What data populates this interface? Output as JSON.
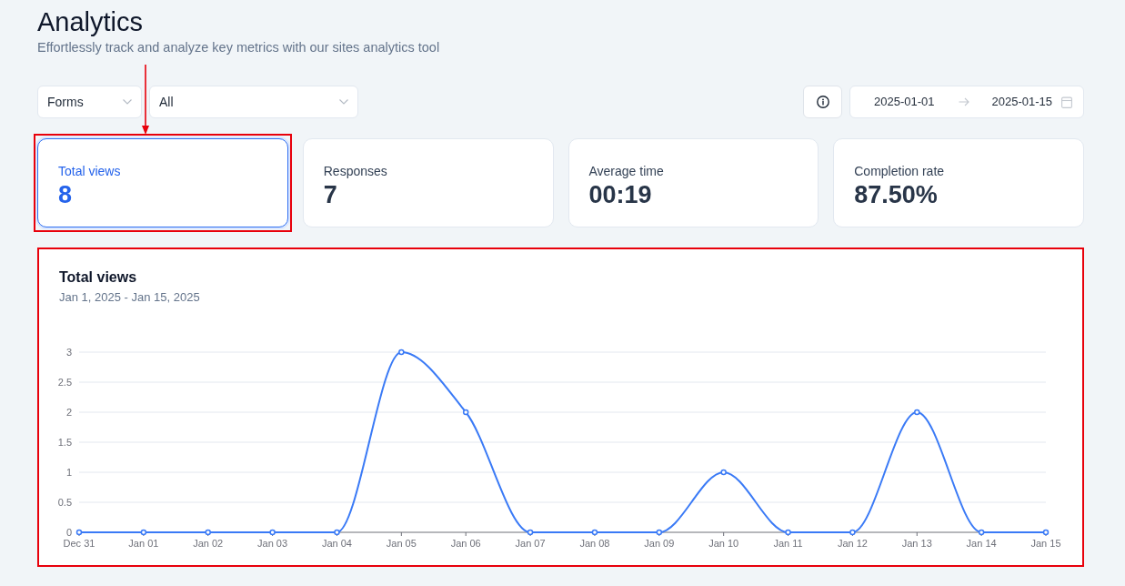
{
  "page": {
    "title": "Analytics",
    "subtitle": "Effortlessly track and analyze key metrics with our sites analytics tool"
  },
  "filters": [
    {
      "kind": "select",
      "value": "Forms"
    },
    {
      "kind": "select",
      "value": "All"
    }
  ],
  "date_range": {
    "start": "2025-01-01",
    "end": "2025-01-15"
  },
  "metrics": [
    {
      "label": "Total views",
      "value": "8",
      "selected": true,
      "highlighted": true,
      "arrow": true
    },
    {
      "label": "Responses",
      "value": "7",
      "selected": false,
      "highlighted": false,
      "arrow": false
    },
    {
      "label": "Average time",
      "value": "00:19",
      "selected": false,
      "highlighted": false,
      "arrow": false
    },
    {
      "label": "Completion rate",
      "value": "87.50%",
      "selected": false,
      "highlighted": false,
      "arrow": false
    }
  ],
  "chart": {
    "highlighted": true,
    "chart_data": [
      {
        "type": "line",
        "title": "Total views",
        "subtitle": "Jan 1, 2025 - Jan 15, 2025",
        "categories": [
          "Dec 31",
          "Jan 01",
          "Jan 02",
          "Jan 03",
          "Jan 04",
          "Jan 05",
          "Jan 06",
          "Jan 07",
          "Jan 08",
          "Jan 09",
          "Jan 10",
          "Jan 11",
          "Jan 12",
          "Jan 13",
          "Jan 14",
          "Jan 15"
        ],
        "values": [
          0,
          0,
          0,
          0,
          0,
          3,
          2,
          0,
          0,
          0,
          1,
          0,
          0,
          2,
          0,
          0
        ],
        "color": "#3a7af6",
        "ylim": [
          0,
          3
        ],
        "yticks": [
          0,
          0.5,
          1,
          1.5,
          2,
          2.5,
          3
        ],
        "grid": true,
        "marker": "circle"
      }
    ]
  }
}
